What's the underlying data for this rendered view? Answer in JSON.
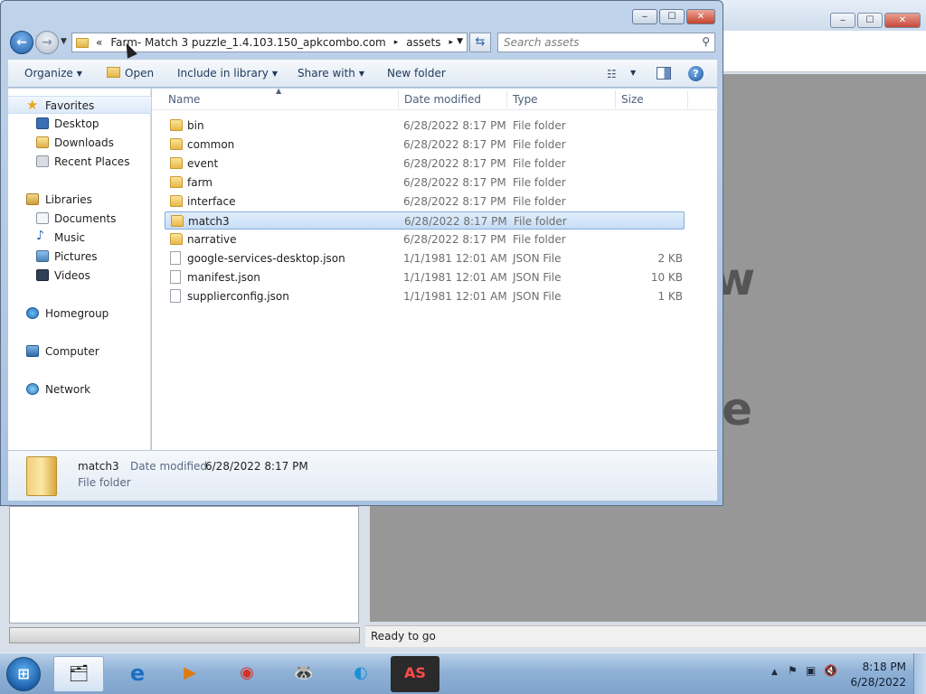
{
  "background_app": {
    "bigtext_1": "w",
    "bigtext_2": "le",
    "status": "Ready to go"
  },
  "explorer": {
    "caption_buttons": {
      "minimize": "‒",
      "maximize": "☐",
      "close": "✕"
    },
    "address": {
      "overflow": "«",
      "crumbs": [
        "Farm- Match 3 puzzle_1.4.103.150_apkcombo.com",
        "assets"
      ],
      "separator": "▸"
    },
    "search": {
      "placeholder": "Search assets"
    },
    "toolbar": {
      "organize": "Organize",
      "open": "Open",
      "include_in_library": "Include in library",
      "share_with": "Share with",
      "new_folder": "New folder"
    },
    "nav": {
      "favorites": "Favorites",
      "desktop": "Desktop",
      "downloads": "Downloads",
      "recent_places": "Recent Places",
      "libraries": "Libraries",
      "documents": "Documents",
      "music": "Music",
      "pictures": "Pictures",
      "videos": "Videos",
      "homegroup": "Homegroup",
      "computer": "Computer",
      "network": "Network"
    },
    "columns": {
      "name": "Name",
      "date_modified": "Date modified",
      "type": "Type",
      "size": "Size"
    },
    "files": [
      {
        "name": "bin",
        "date": "6/28/2022 8:17 PM",
        "type": "File folder",
        "size": "",
        "kind": "folder"
      },
      {
        "name": "common",
        "date": "6/28/2022 8:17 PM",
        "type": "File folder",
        "size": "",
        "kind": "folder"
      },
      {
        "name": "event",
        "date": "6/28/2022 8:17 PM",
        "type": "File folder",
        "size": "",
        "kind": "folder"
      },
      {
        "name": "farm",
        "date": "6/28/2022 8:17 PM",
        "type": "File folder",
        "size": "",
        "kind": "folder"
      },
      {
        "name": "interface",
        "date": "6/28/2022 8:17 PM",
        "type": "File folder",
        "size": "",
        "kind": "folder"
      },
      {
        "name": "match3",
        "date": "6/28/2022 8:17 PM",
        "type": "File folder",
        "size": "",
        "kind": "folder"
      },
      {
        "name": "narrative",
        "date": "6/28/2022 8:17 PM",
        "type": "File folder",
        "size": "",
        "kind": "folder"
      },
      {
        "name": "google-services-desktop.json",
        "date": "1/1/1981 12:01 AM",
        "type": "JSON File",
        "size": "2 KB",
        "kind": "file"
      },
      {
        "name": "manifest.json",
        "date": "1/1/1981 12:01 AM",
        "type": "JSON File",
        "size": "10 KB",
        "kind": "file"
      },
      {
        "name": "supplierconfig.json",
        "date": "1/1/1981 12:01 AM",
        "type": "JSON File",
        "size": "1 KB",
        "kind": "file"
      }
    ],
    "selected_index": 5,
    "details": {
      "name": "match3",
      "date_modified_label": "Date modified:",
      "date_modified": "6/28/2022 8:17 PM",
      "type": "File folder"
    }
  },
  "taskbar": {
    "start": "⊞",
    "apps": [
      {
        "name": "windows-explorer",
        "glyph": "🗂"
      },
      {
        "name": "internet-explorer",
        "glyph": "e"
      },
      {
        "name": "media-player",
        "glyph": "▶"
      },
      {
        "name": "chrome",
        "glyph": "◉"
      },
      {
        "name": "raccoon-app",
        "glyph": "🦝"
      },
      {
        "name": "edge",
        "glyph": "◐"
      },
      {
        "name": "as-app",
        "glyph": "AS"
      }
    ],
    "clock": {
      "time": "8:18 PM",
      "date": "6/28/2022"
    }
  },
  "colors": {
    "selection": "#cce0f7",
    "accent": "#1e5ea8"
  }
}
